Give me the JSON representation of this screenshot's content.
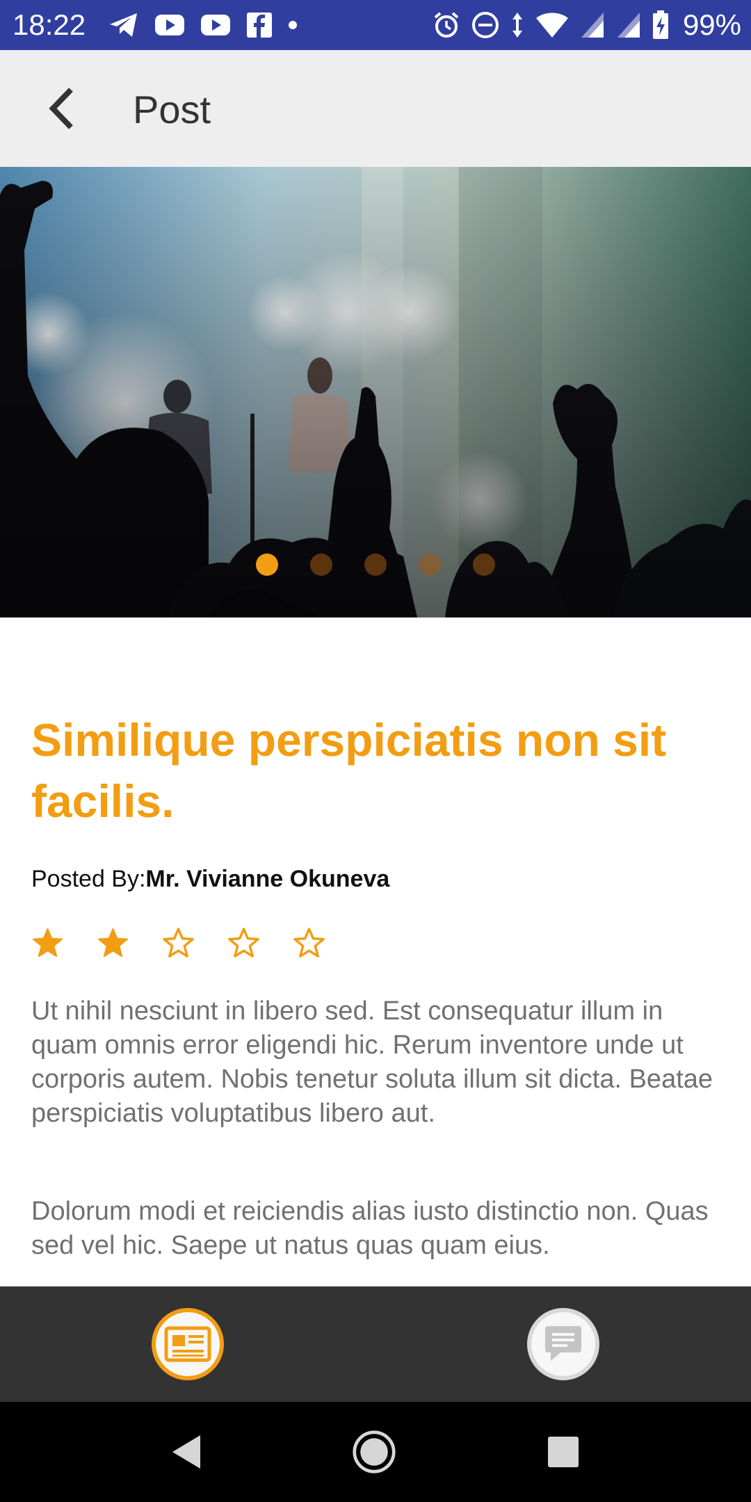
{
  "status_bar": {
    "time": "18:22",
    "left_icons": [
      "telegram-icon",
      "youtube-icon",
      "youtube-icon",
      "facebook-icon",
      "dot-icon"
    ],
    "right_icons": [
      "alarm-icon",
      "do-not-disturb-icon",
      "data-arrows-icon",
      "wifi-icon",
      "signal-icon",
      "signal-icon",
      "battery-charging-icon"
    ],
    "battery": "99%",
    "background": "#303f9f"
  },
  "app_bar": {
    "title": "Post",
    "back_icon": "chevron-left-icon"
  },
  "carousel": {
    "image_description": "concert-crowd-photo",
    "dot_count": 5,
    "active_index": 0,
    "active_color": "#f29d12"
  },
  "post": {
    "title": "Similique perspiciatis non sit facilis.",
    "posted_by_label": "Posted By:",
    "author": "Mr. Vivianne Okuneva",
    "rating": 2,
    "rating_max": 5,
    "paragraphs": [
      "Ut nihil nesciunt in libero sed. Est consequatur illum in quam omnis error eligendi hic. Rerum inventore unde ut corporis autem. Nobis tenetur soluta illum sit dicta. Beatae perspiciatis voluptatibus libero aut.",
      "Dolorum modi et reiciendis alias iusto distinctio non. Quas sed vel hic. Saepe ut natus quas quam eius."
    ]
  },
  "bottom_nav": {
    "items": [
      {
        "icon": "newspaper-icon",
        "active": true
      },
      {
        "icon": "chat-icon",
        "active": false
      }
    ]
  },
  "system_nav": {
    "buttons": [
      "back-triangle-icon",
      "home-circle-icon",
      "recents-square-icon"
    ]
  },
  "colors": {
    "accent": "#f29d12",
    "app_bar": "#eeeeee",
    "bottom_nav": "#333333"
  }
}
